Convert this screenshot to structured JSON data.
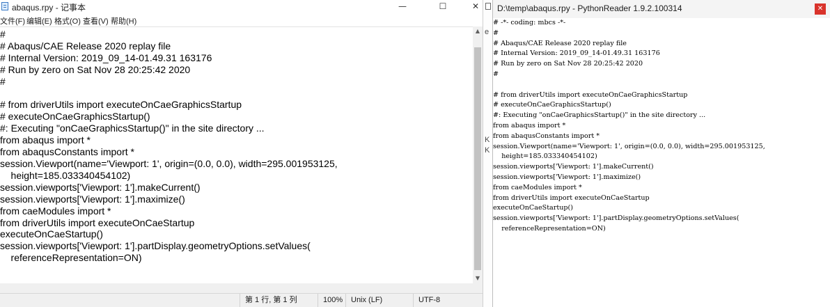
{
  "notepad": {
    "title": "abaqus.rpy - 记事本",
    "menu": [
      "文件(F)",
      "编辑(E)",
      "格式(O)",
      "查看(V)",
      "帮助(H)"
    ],
    "caption_buttons": {
      "minimize": "—",
      "maximize": "☐",
      "close": "✕"
    },
    "content": "#\n# Abaqus/CAE Release 2020 replay file\n# Internal Version: 2019_09_14-01.49.31 163176\n# Run by zero on Sat Nov 28 20:25:42 2020\n#\n\n# from driverUtils import executeOnCaeGraphicsStartup\n# executeOnCaeGraphicsStartup()\n#: Executing \"onCaeGraphicsStartup()\" in the site directory ...\nfrom abaqus import *\nfrom abaqusConstants import *\nsession.Viewport(name='Viewport: 1', origin=(0.0, 0.0), width=295.001953125,\n    height=185.033340454102)\nsession.viewports['Viewport: 1'].makeCurrent()\nsession.viewports['Viewport: 1'].maximize()\nfrom caeModules import *\nfrom driverUtils import executeOnCaeStartup\nexecuteOnCaeStartup()\nsession.viewports['Viewport: 1'].partDisplay.geometryOptions.setValues(\n    referenceRepresentation=ON)",
    "status": {
      "position": "第 1 行, 第 1 列",
      "zoom": "100%",
      "line_ending": "Unix (LF)",
      "encoding": "UTF-8"
    }
  },
  "background_fragments": [
    "e",
    "K",
    "K"
  ],
  "reader": {
    "title": "D:\\temp\\abaqus.rpy - PythonReader 1.9.2.100314",
    "close_label": "✕",
    "content": "# -*- coding: mbcs -*-\n#\n# Abaqus/CAE Release 2020 replay file\n# Internal Version: 2019_09_14-01.49.31 163176\n# Run by zero on Sat Nov 28 20:25:42 2020\n#\n\n# from driverUtils import executeOnCaeGraphicsStartup\n# executeOnCaeGraphicsStartup()\n#: Executing \"onCaeGraphicsStartup()\" in the site directory ...\nfrom abaqus import *\nfrom abaqusConstants import *\nsession.Viewport(name='Viewport: 1', origin=(0.0, 0.0), width=295.001953125,\n    height=185.033340454102)\nsession.viewports['Viewport: 1'].makeCurrent()\nsession.viewports['Viewport: 1'].maximize()\nfrom caeModules import *\nfrom driverUtils import executeOnCaeStartup\nexecuteOnCaeStartup()\nsession.viewports['Viewport: 1'].partDisplay.geometryOptions.setValues(\n    referenceRepresentation=ON)"
  }
}
